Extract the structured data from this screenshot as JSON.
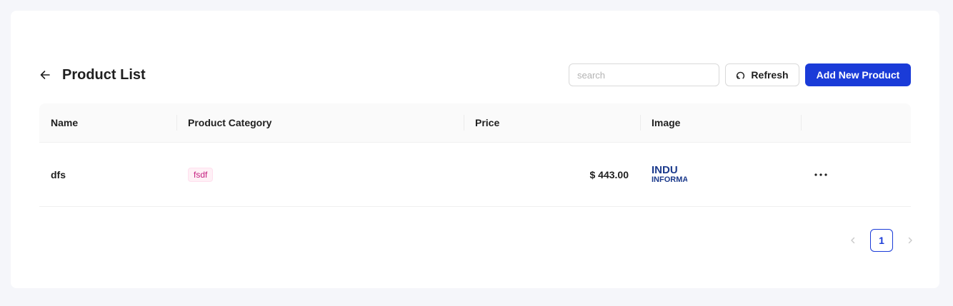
{
  "page": {
    "title": "Product List",
    "back_icon": "arrow-left-icon"
  },
  "toolbar": {
    "search_placeholder": "search",
    "search_value": "",
    "refresh_label": "Refresh",
    "refresh_icon": "reload-icon",
    "add_label": "Add New Product"
  },
  "table": {
    "columns": [
      "Name",
      "Product Category",
      "Price",
      "Image",
      ""
    ],
    "rows": [
      {
        "name": "dfs",
        "category": "fsdf",
        "price": "$ 443.00",
        "image_text": [
          "INDU",
          "INFORMA"
        ],
        "actions_icon": "ellipsis-icon"
      }
    ]
  },
  "pagination": {
    "current_page": "1",
    "prev_icon": "chevron-left-icon",
    "next_icon": "chevron-right-icon"
  },
  "colors": {
    "primary": "#1a3bd8",
    "tag_text": "#c41d7f",
    "tag_bg": "#fff0f6"
  }
}
